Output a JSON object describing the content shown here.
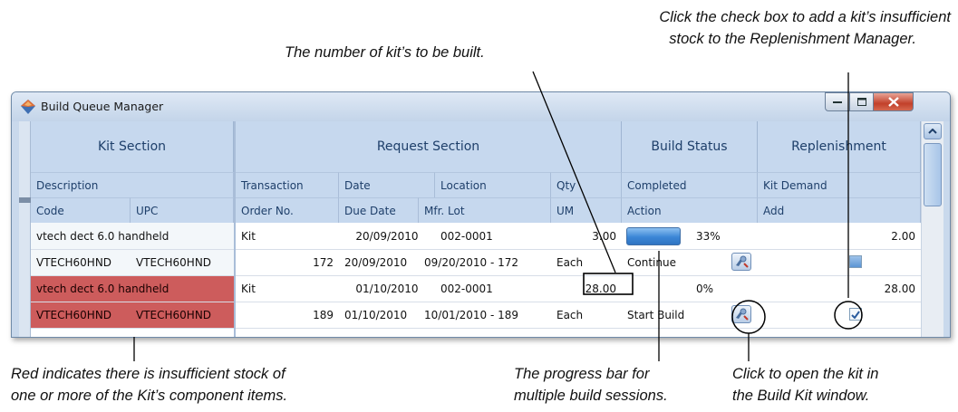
{
  "annotations": {
    "checkbox_note_line1": "Click the check box to add a kit’s insufficient",
    "checkbox_note_line2": "stock to the Replenishment Manager.",
    "qty_note": "The number of kit’s to be built.",
    "red_note_line1": "Red indicates there is insufficient stock of",
    "red_note_line2": "one or more of the Kit’s component items.",
    "progress_note_line1": "The progress bar for",
    "progress_note_line2": "multiple build sessions.",
    "open_kit_note_line1": "Click to open the kit in",
    "open_kit_note_line2": "the Build Kit window."
  },
  "window": {
    "title": "Build Queue Manager",
    "icon": "diamond-app-icon"
  },
  "sections": {
    "kit": "Kit Section",
    "request": "Request Section",
    "build_status": "Build Status",
    "replenishment": "Replenishment"
  },
  "header_row1": {
    "description": "Description",
    "transaction": "Transaction",
    "date": "Date",
    "location": "Location",
    "qty": "Qty",
    "completed": "Completed",
    "kit_demand": "Kit Demand"
  },
  "header_row2": {
    "code": "Code",
    "upc": "UPC",
    "order_no": "Order No.",
    "due_date": "Due Date",
    "mfr_lot": "Mfr. Lot",
    "um": "UM",
    "action": "Action",
    "add": "Add"
  },
  "kits": [
    {
      "description": "vtech dect 6.0 handheld",
      "transaction": "Kit",
      "date": "20/09/2010",
      "location": "002-0001",
      "qty": "3.00",
      "completed": "33%",
      "completed_fraction": 0.33,
      "kit_demand": "2.00",
      "code": "VTECH60HND",
      "upc": "VTECH60HND",
      "order_no": "172",
      "due_date": "20/09/2010",
      "mfr_lot": "09/20/2010 - 172",
      "um": "Each",
      "action": "Continue",
      "add_checked": false,
      "insufficient": false
    },
    {
      "description": "vtech dect 6.0 handheld",
      "transaction": "Kit",
      "date": "01/10/2010",
      "location": "002-0001",
      "qty": "28.00",
      "completed": "0%",
      "completed_fraction": 0,
      "kit_demand": "28.00",
      "code": "VTECH60HND",
      "upc": "VTECH60HND",
      "order_no": "189",
      "due_date": "01/10/2010",
      "mfr_lot": "10/01/2010 - 189",
      "um": "Each",
      "action": "Start Build",
      "add_checked": true,
      "insufficient": true
    }
  ],
  "colors": {
    "insufficient": "#cd5c5c",
    "header": "#c6d8ee",
    "progress": "#3b86d6"
  }
}
